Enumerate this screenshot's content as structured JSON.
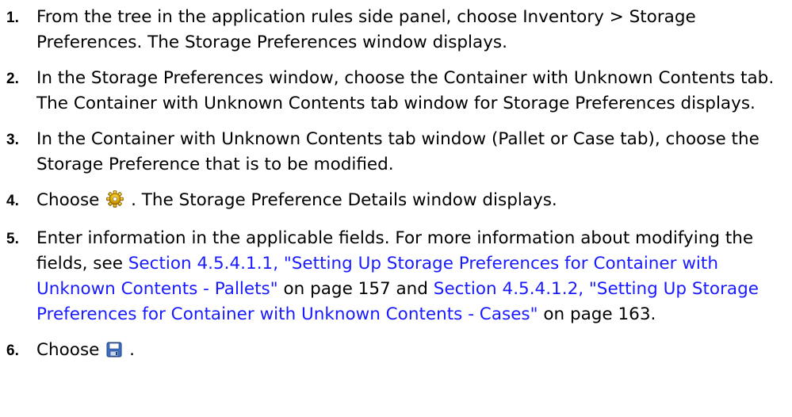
{
  "steps": [
    {
      "number": "1.",
      "text": "From the tree in the application rules side panel, choose Inventory > Storage Preferences. The Storage Preferences window displays."
    },
    {
      "number": "2.",
      "text": "In the Storage Preferences window, choose the Container with Unknown Contents tab. The Container with Unknown Contents tab window for Storage Preferences displays."
    },
    {
      "number": "3.",
      "text": "In the Container with Unknown Contents tab window (Pallet or Case tab), choose the Storage Preference that is to be modified."
    },
    {
      "number": "4.",
      "prefix": "Choose",
      "icon": "gear-icon",
      "suffix": ". The Storage Preference Details window displays."
    },
    {
      "number": "5.",
      "text_a": "Enter information in the applicable fields. For more information about modifying the fields, see ",
      "link_1": "Section 4.5.4.1.1, \"Setting Up Storage Preferences for Container with Unknown Contents - Pallets\"",
      "text_b": " on page 157 and ",
      "link_2": "Section 4.5.4.1.2, \"Setting Up Storage Preferences for Container with Unknown Contents - Cases\"",
      "text_c": " on page 163."
    },
    {
      "number": "6.",
      "prefix": "Choose",
      "icon": "save-icon",
      "suffix": "."
    }
  ],
  "colors": {
    "text": "#000000",
    "link": "#1a1aff"
  }
}
